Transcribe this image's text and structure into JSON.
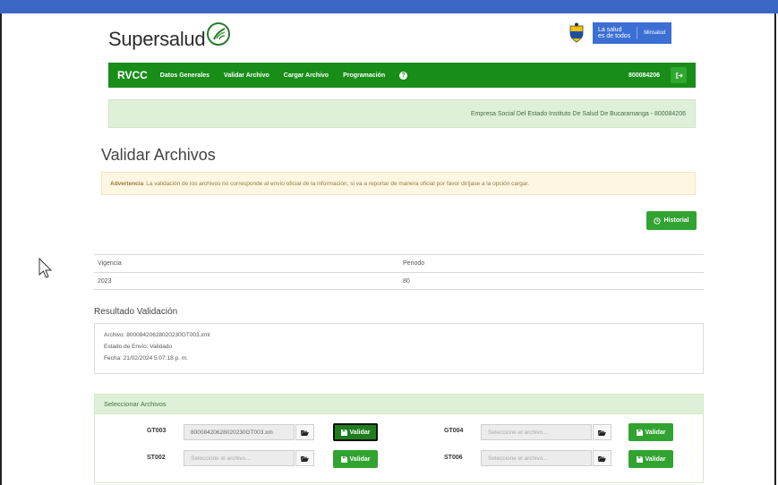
{
  "header": {
    "logo_text": "Supersalud",
    "gov_slogan_1": "La salud",
    "gov_slogan_2": "es de todos",
    "gov_ministry": "Minsalud"
  },
  "navbar": {
    "brand": "RVCC",
    "items": [
      {
        "label": "Datos Generales"
      },
      {
        "label": "Validar Archivo"
      },
      {
        "label": "Cargar Archivo"
      },
      {
        "label": "Programación"
      }
    ],
    "user_id": "800084206"
  },
  "entity_alert": "Empresa Social Del Estado Instituto De Salud De Bucaramanga - 800084206",
  "page_title": "Validar Archivos",
  "warning": {
    "label": "Advertencia",
    "text": "La validación de los archivos no corresponde al envío oficial de la información, si va a reportar de manera oficial por favor diríjase a la opción cargar."
  },
  "historial_button": "Historial",
  "periodo_table": {
    "headers": [
      "Vigencia",
      "Periodo"
    ],
    "values": [
      "2023",
      "80"
    ]
  },
  "resultado": {
    "title": "Resultado Validación",
    "archivo": "Archivo: 80008420628020230GT003.xml",
    "estado": "Estado de Envío: Validado",
    "fecha": "Fecha: 21/02/2024 5:07:18 p. m."
  },
  "seleccionar": {
    "title": "Seleccionar Archivos",
    "placeholder": "Seleccione el archivo...",
    "validar_label": "Validar",
    "files": [
      {
        "code": "GT003",
        "value": "80008420628020230GT003.xm"
      },
      {
        "code": "GT004",
        "value": ""
      },
      {
        "code": "ST002",
        "value": ""
      },
      {
        "code": "ST006",
        "value": ""
      }
    ]
  },
  "colors": {
    "nav_green": "#188d18",
    "top_bar_blue": "#3a66c4",
    "alert_green_bg": "#dff0d8",
    "warning_bg": "#fcf6e3"
  }
}
